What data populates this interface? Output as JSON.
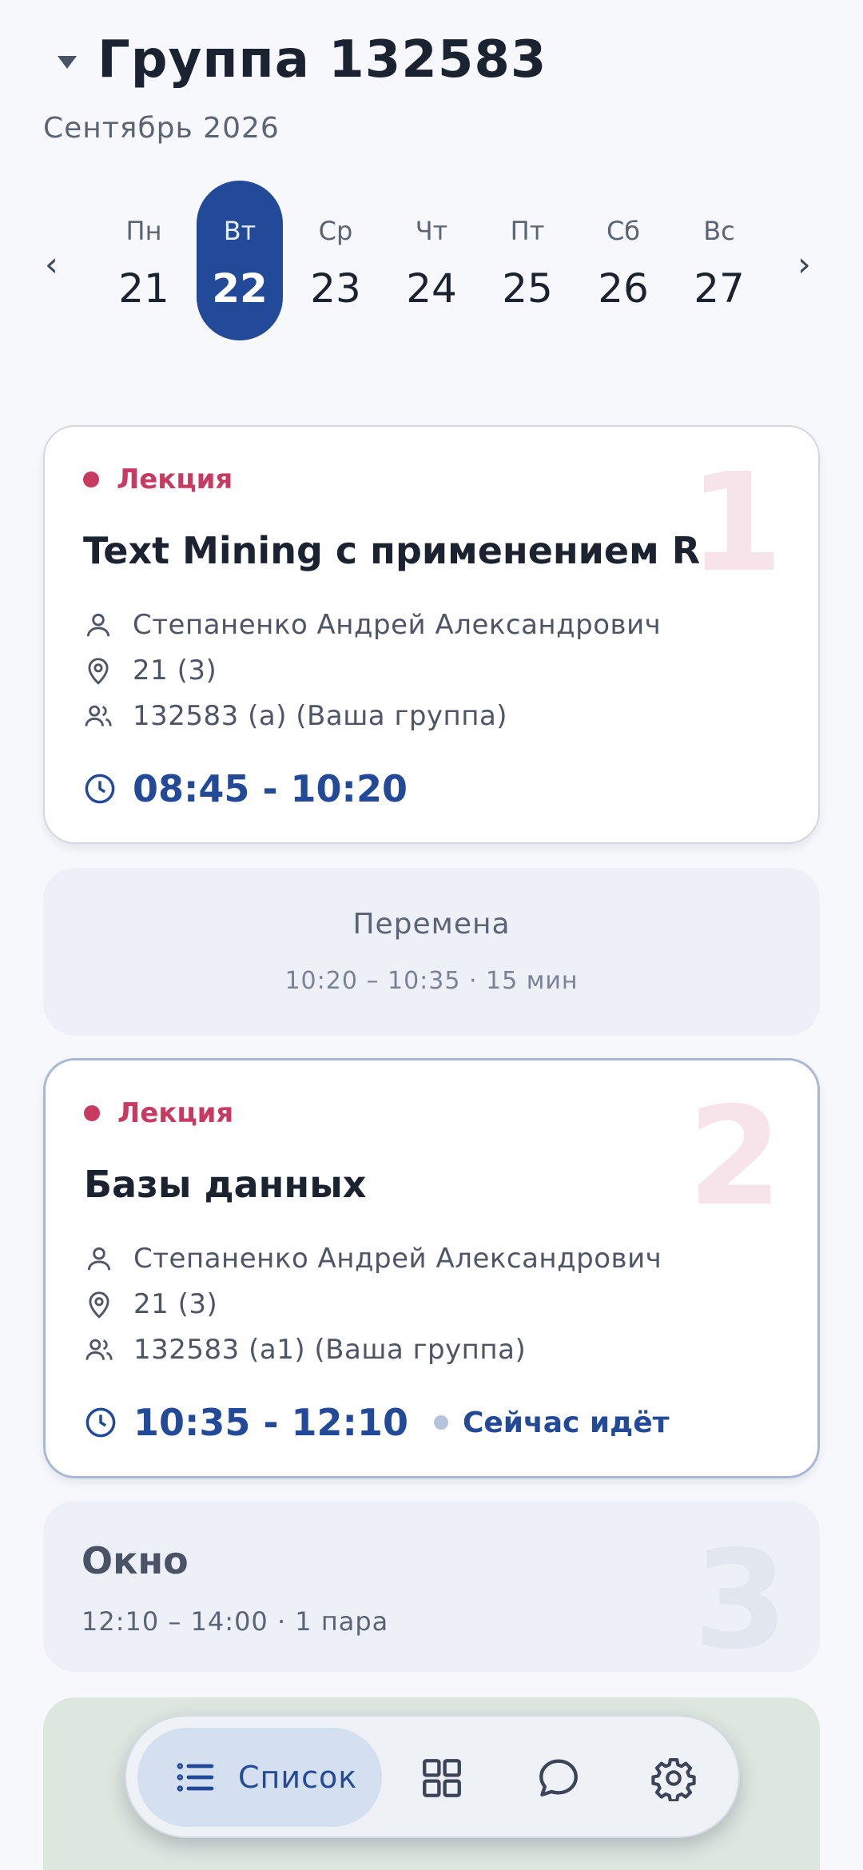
{
  "header": {
    "title": "Группа 132583",
    "month": "Сентябрь 2026"
  },
  "week": {
    "prev_icon": "chevron-left-icon",
    "next_icon": "chevron-right-icon",
    "days": [
      {
        "name": "Пн",
        "date": "21",
        "selected": false
      },
      {
        "name": "Вт",
        "date": "22",
        "selected": true
      },
      {
        "name": "Ср",
        "date": "23",
        "selected": false
      },
      {
        "name": "Чт",
        "date": "24",
        "selected": false
      },
      {
        "name": "Пт",
        "date": "25",
        "selected": false
      },
      {
        "name": "Сб",
        "date": "26",
        "selected": false
      },
      {
        "name": "Вс",
        "date": "27",
        "selected": false
      }
    ]
  },
  "lessons": [
    {
      "number": "1",
      "type": "Лекция",
      "subject": "Text Mining с применением R",
      "teacher": "Степаненко Андрей Александрович",
      "room": "21 (3)",
      "group": "132583 (а) (Ваша группа)",
      "time": "08:45 - 10:20"
    },
    {
      "number": "2",
      "type": "Лекция",
      "subject": "Базы данных",
      "teacher": "Степаненко Андрей Александрович",
      "room": "21 (3)",
      "group": "132583 (а1) (Ваша группа)",
      "time": "10:35 - 12:10",
      "status": "Сейчас идёт"
    }
  ],
  "break": {
    "title": "Перемена",
    "subtitle": "10:20 – 10:35 · 15 мин"
  },
  "window": {
    "number": "3",
    "title": "Окно",
    "subtitle": "12:10 – 14:00 · 1 пара"
  },
  "nav": {
    "list_label": "Список",
    "items": [
      "list-icon",
      "grid-icon",
      "chat-icon",
      "gear-icon"
    ]
  },
  "colors": {
    "accent": "#234a98",
    "lecture": "#c83a62",
    "background": "#f6f8fc"
  }
}
